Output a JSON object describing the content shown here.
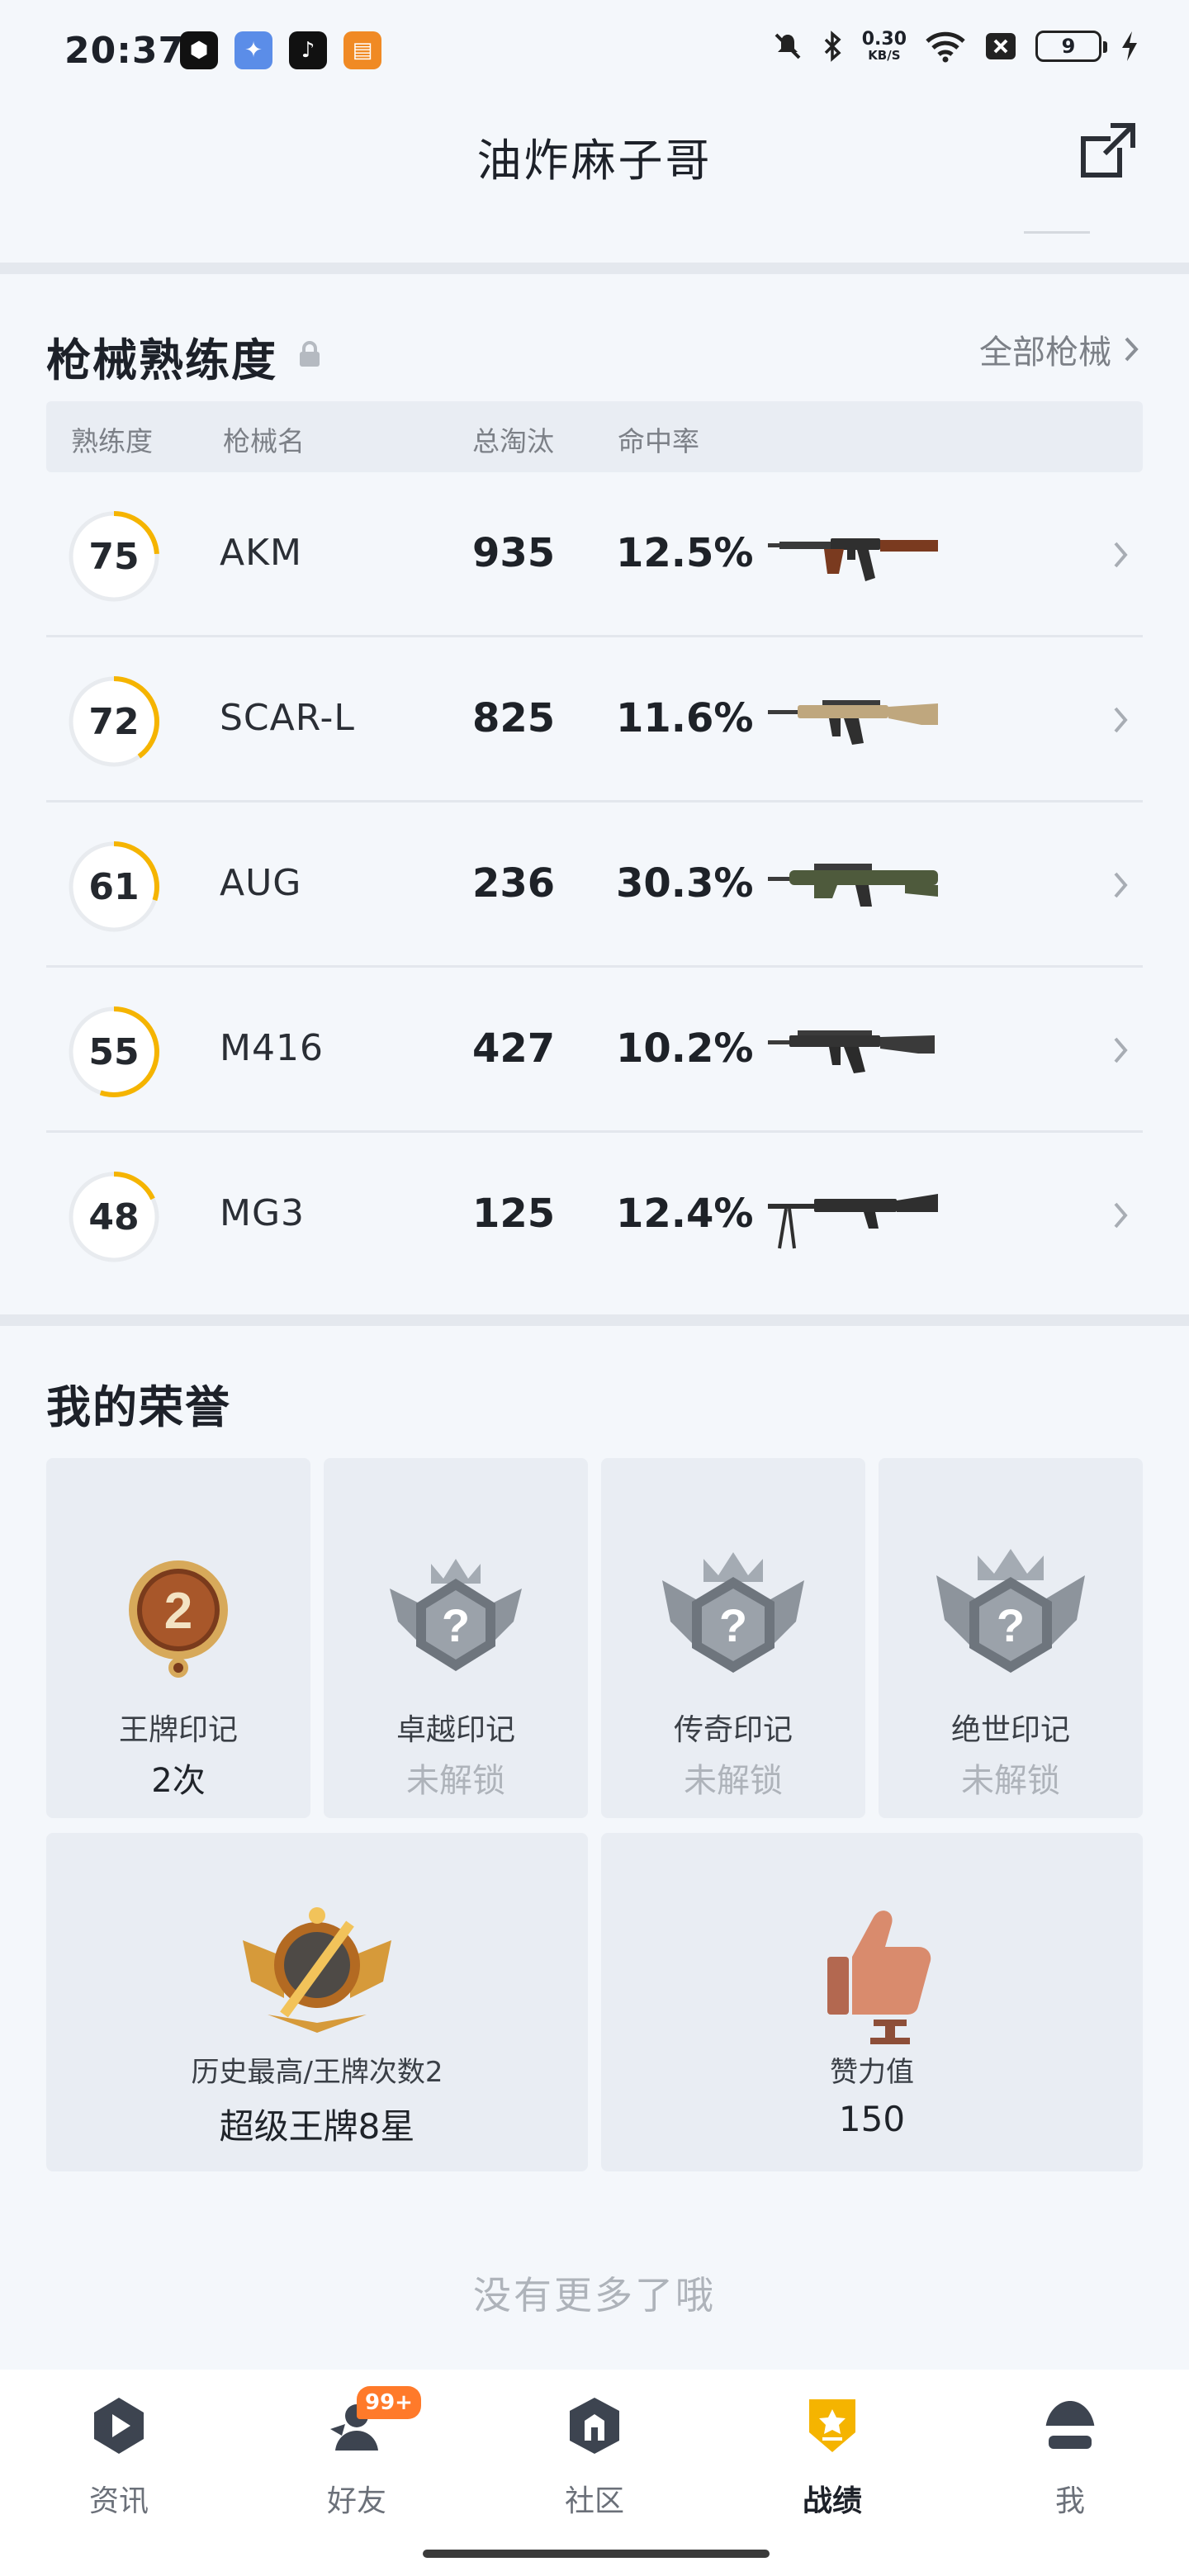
{
  "status_bar": {
    "time": "20:37",
    "net_speed_value": "0.30",
    "net_speed_unit": "KB/S",
    "battery": "9",
    "icons": [
      "mute-icon",
      "bluetooth-icon",
      "wifi-icon",
      "sim-off-icon",
      "charging-icon"
    ]
  },
  "header": {
    "title": "油炸麻子哥",
    "share_icon": "share-external-icon"
  },
  "mastery": {
    "title": "枪械熟练度",
    "all_link": "全部枪械",
    "columns": {
      "level": "熟练度",
      "name": "枪械名",
      "kills": "总淘汰",
      "accuracy": "命中率"
    },
    "rows": [
      {
        "level": "75",
        "name": "AKM",
        "kills": "935",
        "accuracy": "12.5%",
        "progress": 0.24
      },
      {
        "level": "72",
        "name": "SCAR-L",
        "kills": "825",
        "accuracy": "11.6%",
        "progress": 0.4
      },
      {
        "level": "61",
        "name": "AUG",
        "kills": "236",
        "accuracy": "30.3%",
        "progress": 0.3
      },
      {
        "level": "55",
        "name": "M416",
        "kills": "427",
        "accuracy": "10.2%",
        "progress": 0.55
      },
      {
        "level": "48",
        "name": "MG3",
        "kills": "125",
        "accuracy": "12.4%",
        "progress": 0.18
      }
    ],
    "ring_color": "#f5b400"
  },
  "honors": {
    "title": "我的荣誉",
    "badges": [
      {
        "name": "王牌印记",
        "value": "2次",
        "locked": false,
        "icon": "ace-medal-icon"
      },
      {
        "name": "卓越印记",
        "value": "未解锁",
        "locked": true,
        "icon": "locked-silver-badge-icon"
      },
      {
        "name": "传奇印记",
        "value": "未解锁",
        "locked": true,
        "icon": "locked-silver-badge-icon"
      },
      {
        "name": "绝世印记",
        "value": "未解锁",
        "locked": true,
        "icon": "locked-silver-badge-icon"
      }
    ],
    "highest": {
      "name": "历史最高/王牌次数2",
      "value": "超级王牌8星",
      "icon": "super-ace-emblem-icon"
    },
    "likes": {
      "name": "赞力值",
      "value": "150",
      "icon": "thumbs-up-trophy-icon"
    },
    "end_text": "没有更多了哦"
  },
  "tabs": [
    {
      "label": "资讯",
      "icon": "news-play-icon",
      "active": false
    },
    {
      "label": "好友",
      "icon": "friends-icon",
      "active": false,
      "badge": "99+"
    },
    {
      "label": "社区",
      "icon": "community-icon",
      "active": false
    },
    {
      "label": "战绩",
      "icon": "record-shield-icon",
      "active": true
    },
    {
      "label": "我",
      "icon": "helmet-icon",
      "active": false
    }
  ]
}
